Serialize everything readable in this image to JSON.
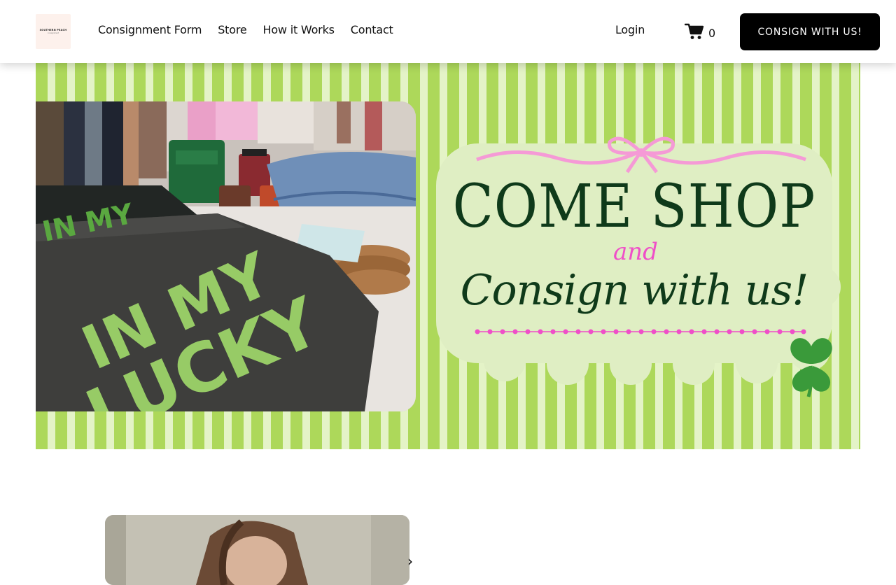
{
  "header": {
    "logo_text": "SOUTHERN PEACH",
    "logo_sub": "consignment",
    "nav": [
      {
        "label": "Consignment Form"
      },
      {
        "label": "Store"
      },
      {
        "label": "How it Works"
      },
      {
        "label": "Contact"
      }
    ],
    "login_label": "Login",
    "cart_count": "0",
    "cta_label": "CONSIGN WITH US!"
  },
  "banner": {
    "headline": "COME SHOP",
    "and_text": "and",
    "subheadline": "Consign with us!",
    "shirt_text_1": "IN MY",
    "shirt_text_2": "LUCKY",
    "colors": {
      "stripe_green": "#add85a",
      "stripe_light": "#e4f3c7",
      "text_dark_green": "#0f3a1a",
      "accent_pink": "#ef4fc8",
      "ribbon_pink": "#f59ad6",
      "clover_green": "#3a9a3a"
    }
  }
}
